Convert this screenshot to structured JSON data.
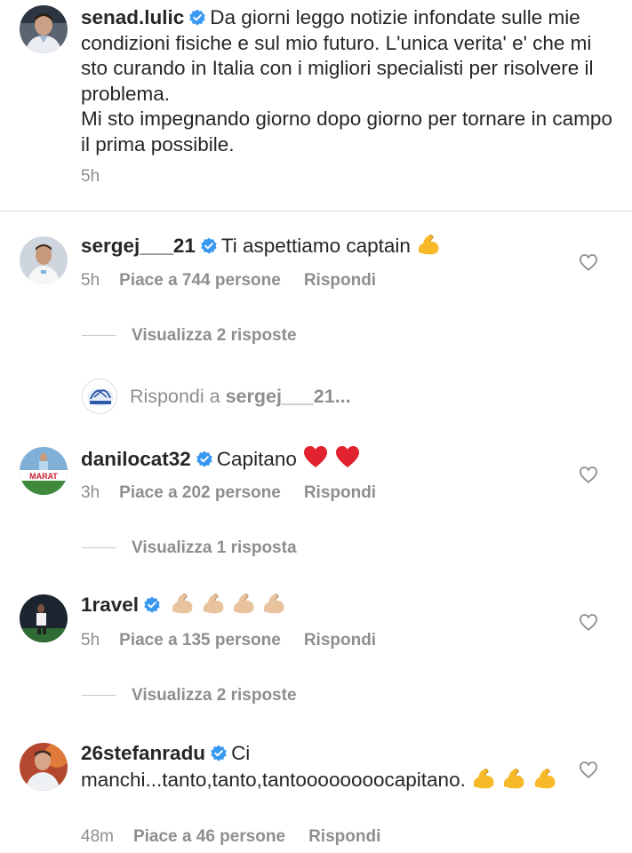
{
  "caption": {
    "username": "senad.lulic",
    "paragraph1": "Da giorni leggo notizie infondate sulle mie condizioni fisiche e sul mio futuro. L'unica verita' e' che mi sto curando in Italia con i migliori specialisti per risolvere il problema.",
    "paragraph2": "Mi sto impegnando giorno dopo giorno per tornare in campo il prima possibile.",
    "time": "5h"
  },
  "comments": [
    {
      "username": "sergej___21",
      "text": "Ti aspettiamo captain",
      "time": "5h",
      "likes": "Piace a 744 persone",
      "reply": "Rispondi",
      "view_replies": "Visualizza 2 risposte"
    },
    {
      "username": "danilocat32",
      "text": "Capitano",
      "time": "3h",
      "likes": "Piace a 202 persone",
      "reply": "Rispondi",
      "view_replies": "Visualizza 1 risposta"
    },
    {
      "username": "1ravel",
      "text": "",
      "time": "5h",
      "likes": "Piace a 135 persone",
      "reply": "Rispondi",
      "view_replies": "Visualizza 2 risposte"
    },
    {
      "username": "26stefanradu",
      "text": "Ci manchi...tanto,tanto,tantoooooooocapitano.",
      "time": "48m",
      "likes": "Piace a 46 persone",
      "reply": "Rispondi"
    }
  ],
  "reply_box": {
    "prefix": "Rispondi a",
    "target": "sergej___21..."
  },
  "avatar_texts": {
    "danilocat_banner": "MARAT"
  },
  "colors": {
    "verified": "#3897f0",
    "secondary_text": "#8e8e8e",
    "heart_red": "#e0232e",
    "muscle_yellow": "#f7b928",
    "muscle_skin": "#e8c39e"
  },
  "icons": [
    "verified-badge-icon",
    "heart-outline-icon",
    "flexed-biceps-emoji",
    "red-heart-emoji"
  ]
}
